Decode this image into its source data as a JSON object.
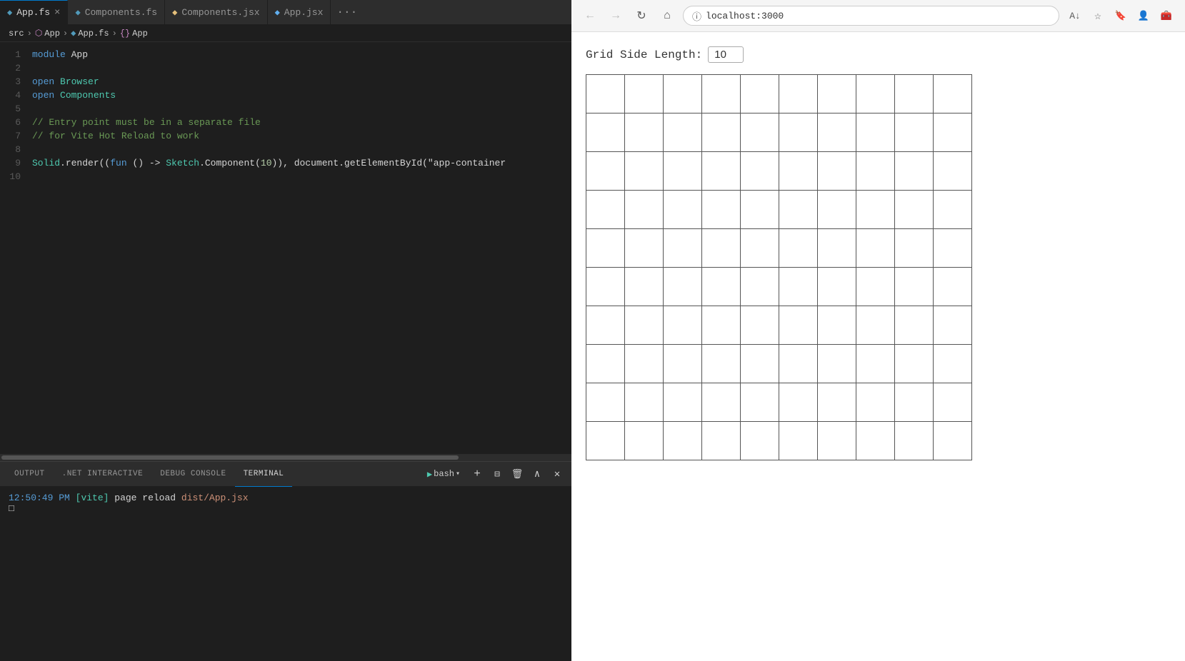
{
  "editor": {
    "tabs": [
      {
        "id": "app-fs",
        "label": "App.fs",
        "icon": "fs",
        "active": true,
        "closeable": true
      },
      {
        "id": "components-fs",
        "label": "Components.fs",
        "icon": "fs",
        "active": false,
        "closeable": false
      },
      {
        "id": "components-jsx",
        "label": "Components.jsx",
        "icon": "jsx",
        "active": false,
        "closeable": false
      },
      {
        "id": "app-jsx",
        "label": "App.jsx",
        "icon": "jsx",
        "active": false,
        "closeable": false
      }
    ],
    "breadcrumb": {
      "src": "src",
      "app": "App",
      "filename": "App.fs",
      "symbol": "{} App"
    },
    "lines": [
      {
        "num": 1,
        "tokens": [
          {
            "t": "kw",
            "v": "module"
          },
          {
            "t": "punc",
            "v": " App"
          }
        ]
      },
      {
        "num": 2,
        "tokens": []
      },
      {
        "num": 3,
        "tokens": [
          {
            "t": "kw",
            "v": "open"
          },
          {
            "t": "punc",
            "v": " "
          },
          {
            "t": "type",
            "v": "Browser"
          }
        ]
      },
      {
        "num": 4,
        "tokens": [
          {
            "t": "kw",
            "v": "open"
          },
          {
            "t": "punc",
            "v": " "
          },
          {
            "t": "type",
            "v": "Components"
          }
        ]
      },
      {
        "num": 5,
        "tokens": []
      },
      {
        "num": 6,
        "tokens": [
          {
            "t": "comment",
            "v": "// Entry point must be in a separate file"
          }
        ]
      },
      {
        "num": 7,
        "tokens": [
          {
            "t": "comment",
            "v": "// for Vite Hot Reload to work"
          }
        ]
      },
      {
        "num": 8,
        "tokens": []
      },
      {
        "num": 9,
        "tokens": [
          {
            "t": "type",
            "v": "Solid"
          },
          {
            "t": "punc",
            "v": ".render(("
          },
          {
            "t": "kw",
            "v": "fun"
          },
          {
            "t": "punc",
            "v": " () -> "
          },
          {
            "t": "type",
            "v": "Sketch"
          },
          {
            "t": "punc",
            "v": ".Component("
          },
          {
            "t": "num",
            "v": "10"
          },
          {
            "t": "punc",
            "v": ")), document.getElementById(\"app-container"
          }
        ]
      },
      {
        "num": 10,
        "tokens": []
      }
    ]
  },
  "bottomPanel": {
    "tabs": [
      {
        "id": "output",
        "label": "OUTPUT",
        "active": false
      },
      {
        "id": "net-interactive",
        "label": ".NET INTERACTIVE",
        "active": false
      },
      {
        "id": "debug-console",
        "label": "DEBUG CONSOLE",
        "active": false
      },
      {
        "id": "terminal",
        "label": "TERMINAL",
        "active": true
      }
    ],
    "terminalShell": "bash",
    "terminalLine": {
      "time": "12:50:49 PM",
      "tag": "[vite]",
      "message": "page reload",
      "path": "dist/App.jsx"
    },
    "actions": {
      "run": "▶",
      "add": "+",
      "split": "⊟",
      "trash": "🗑",
      "maximize": "∧",
      "close": "✕"
    }
  },
  "browser": {
    "url": "localhost:3000",
    "gridLabel": "Grid Side Length:",
    "gridValue": "10",
    "gridSize": 10
  }
}
